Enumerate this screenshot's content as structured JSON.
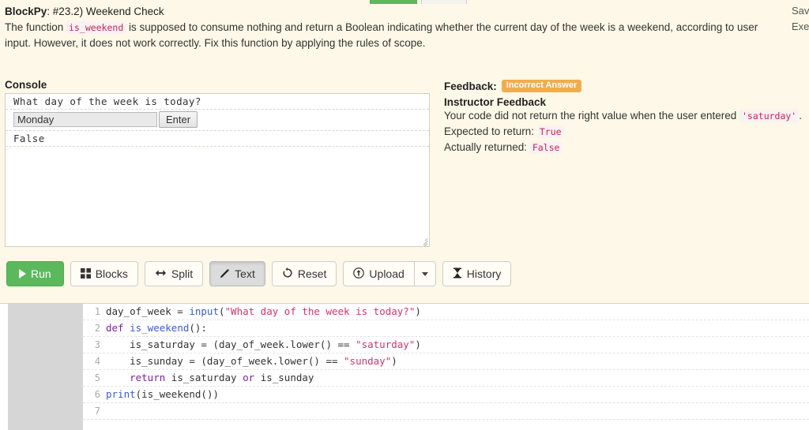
{
  "top_partial_buttons": {
    "green_label": "",
    "gray_label": ""
  },
  "header": {
    "app_name": "BlockPy",
    "separator": ": ",
    "problem_id": "#23.2) Weekend Check",
    "desc_part1": "The function ",
    "desc_code": "is_weekend",
    "desc_part2": " is supposed to consume nothing and return a Boolean indicating whether the current day of the week is a weekend, according to user input. However, it does not work correctly. Fix this function by applying the rules of scope."
  },
  "right_links": {
    "line1": "Save",
    "line2": "Exercise"
  },
  "console": {
    "label": "Console",
    "prompt": "What day of the week is today?",
    "input_value": "Monday",
    "input_placeholder": "",
    "enter_label": "Enter",
    "output": "False"
  },
  "feedback": {
    "label": "Feedback:",
    "badge": "Incorrect Answer",
    "subtitle": "Instructor Feedback",
    "message_pre": "Your code did not return the right value when the user entered ",
    "message_code": "'saturday'",
    "message_post": ".",
    "expected_label": "Expected to return:",
    "expected_value": "True",
    "actual_label": "Actually returned:",
    "actual_value": "False"
  },
  "toolbar": {
    "run_label": "Run",
    "blocks_label": "Blocks",
    "split_label": "Split",
    "text_label": "Text",
    "reset_label": "Reset",
    "upload_label": "Upload",
    "history_label": "History",
    "icons": {
      "run": "play-icon",
      "blocks": "grid-icon",
      "split": "arrows-horizontal-icon",
      "text": "pencil-icon",
      "reset": "refresh-icon",
      "upload": "upload-circle-icon",
      "caret": "chevron-down-icon",
      "history": "hourglass-icon"
    },
    "active_button": "Text"
  },
  "editor": {
    "lines": [
      {
        "num": "1",
        "segments": [
          {
            "t": "day_of_week = ",
            "c": "tok-plain"
          },
          {
            "t": "input",
            "c": "tok-fn"
          },
          {
            "t": "(",
            "c": "tok-plain"
          },
          {
            "t": "\"What day of the week is today?\"",
            "c": "tok-str"
          },
          {
            "t": ")",
            "c": "tok-plain"
          }
        ]
      },
      {
        "num": "2",
        "segments": [
          {
            "t": "def ",
            "c": "tok-kw"
          },
          {
            "t": "is_weekend",
            "c": "tok-def"
          },
          {
            "t": "():",
            "c": "tok-plain"
          }
        ]
      },
      {
        "num": "3",
        "segments": [
          {
            "t": "    is_saturday = (day_of_week.lower() == ",
            "c": "tok-plain"
          },
          {
            "t": "\"saturday\"",
            "c": "tok-str"
          },
          {
            "t": ")",
            "c": "tok-plain"
          }
        ]
      },
      {
        "num": "4",
        "segments": [
          {
            "t": "    is_sunday = (day_of_week.lower() == ",
            "c": "tok-plain"
          },
          {
            "t": "\"sunday\"",
            "c": "tok-str"
          },
          {
            "t": ")",
            "c": "tok-plain"
          }
        ]
      },
      {
        "num": "5",
        "segments": [
          {
            "t": "    ",
            "c": "tok-plain"
          },
          {
            "t": "return",
            "c": "tok-kw"
          },
          {
            "t": " is_saturday ",
            "c": "tok-plain"
          },
          {
            "t": "or",
            "c": "tok-op"
          },
          {
            "t": " is_sunday",
            "c": "tok-plain"
          }
        ]
      },
      {
        "num": "6",
        "segments": [
          {
            "t": "print",
            "c": "tok-fn"
          },
          {
            "t": "(is_weekend())",
            "c": "tok-plain"
          }
        ]
      },
      {
        "num": "7",
        "segments": []
      }
    ]
  },
  "colors": {
    "page_background": "#fdf8e7",
    "run_green": "#5cb85c",
    "badge_orange": "#f0ad4e",
    "inline_code_text": "#c7254e",
    "inline_code_bg": "#f9f2f4",
    "blocks_pane_gray": "#d6d6d6"
  }
}
